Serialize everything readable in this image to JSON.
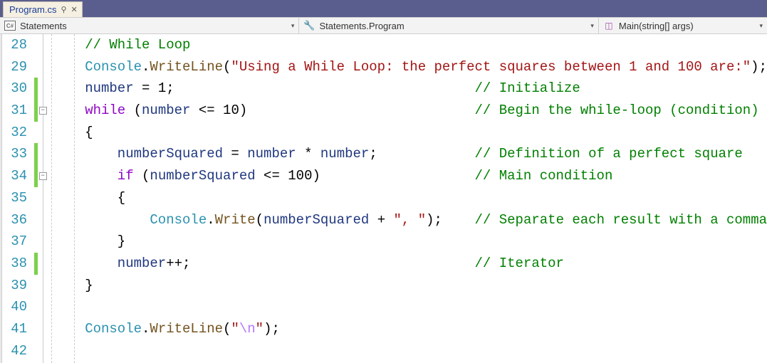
{
  "tab": {
    "title": "Program.cs",
    "pin_glyph": "⚲",
    "close_glyph": "✕"
  },
  "nav": {
    "namespace": "Statements",
    "class": "Statements.Program",
    "method": "Main(string[] args)",
    "csharp_badge": "C#",
    "class_glyph": "🔧",
    "method_glyph": "◫"
  },
  "gutter": {
    "start": 28,
    "end": 42
  },
  "outline": {
    "minus": "−"
  },
  "code": {
    "lines": [
      {
        "n": 28,
        "indent": 0,
        "segs": [
          [
            "comment",
            "// While Loop"
          ]
        ]
      },
      {
        "n": 29,
        "indent": 0,
        "segs": [
          [
            "type",
            "Console"
          ],
          [
            "punc",
            "."
          ],
          [
            "method",
            "WriteLine"
          ],
          [
            "punc",
            "("
          ],
          [
            "string",
            "\"Using a While Loop: the perfect squares between 1 and 100 are:\""
          ],
          [
            "punc",
            ");"
          ]
        ]
      },
      {
        "n": 30,
        "indent": 0,
        "segs": [
          [
            "ident",
            "number"
          ],
          [
            "op",
            " = "
          ],
          [
            "punc",
            "1;"
          ]
        ],
        "comment": "// Initialize",
        "chg": true
      },
      {
        "n": 31,
        "indent": 0,
        "segs": [
          [
            "flow",
            "while"
          ],
          [
            "punc",
            " ("
          ],
          [
            "ident",
            "number"
          ],
          [
            "op",
            " <= "
          ],
          [
            "punc",
            "10)"
          ]
        ],
        "comment": "// Begin the while-loop (condition)",
        "chg": true,
        "fold": true
      },
      {
        "n": 32,
        "indent": 0,
        "segs": [
          [
            "punc",
            "{"
          ]
        ]
      },
      {
        "n": 33,
        "indent": 1,
        "segs": [
          [
            "ident",
            "numberSquared"
          ],
          [
            "op",
            " = "
          ],
          [
            "ident",
            "number"
          ],
          [
            "op",
            " * "
          ],
          [
            "ident",
            "number"
          ],
          [
            "punc",
            ";"
          ]
        ],
        "comment": "// Definition of a perfect square",
        "chg": true
      },
      {
        "n": 34,
        "indent": 1,
        "segs": [
          [
            "flow",
            "if"
          ],
          [
            "punc",
            " ("
          ],
          [
            "ident",
            "numberSquared"
          ],
          [
            "op",
            " <= "
          ],
          [
            "punc",
            "100)"
          ]
        ],
        "comment": "// Main condition",
        "chg": true,
        "fold": true
      },
      {
        "n": 35,
        "indent": 1,
        "segs": [
          [
            "punc",
            "{"
          ]
        ]
      },
      {
        "n": 36,
        "indent": 2,
        "segs": [
          [
            "type",
            "Console"
          ],
          [
            "punc",
            "."
          ],
          [
            "method",
            "Write"
          ],
          [
            "punc",
            "("
          ],
          [
            "ident",
            "numberSquared"
          ],
          [
            "op",
            " + "
          ],
          [
            "string",
            "\", \""
          ],
          [
            "punc",
            ");"
          ]
        ],
        "comment": "// Separate each result with a comma"
      },
      {
        "n": 37,
        "indent": 1,
        "segs": [
          [
            "punc",
            "}"
          ]
        ]
      },
      {
        "n": 38,
        "indent": 1,
        "segs": [
          [
            "ident",
            "number"
          ],
          [
            "op",
            "++;"
          ]
        ],
        "comment": "// Iterator",
        "chg": true
      },
      {
        "n": 39,
        "indent": 0,
        "segs": [
          [
            "punc",
            "}"
          ]
        ]
      },
      {
        "n": 40,
        "indent": 0,
        "segs": []
      },
      {
        "n": 41,
        "indent": 0,
        "segs": [
          [
            "type",
            "Console"
          ],
          [
            "punc",
            "."
          ],
          [
            "method",
            "WriteLine"
          ],
          [
            "punc",
            "("
          ],
          [
            "string",
            "\""
          ],
          [
            "escape",
            "\\n"
          ],
          [
            "string",
            "\""
          ],
          [
            "punc",
            ");"
          ]
        ]
      },
      {
        "n": 42,
        "indent": 0,
        "segs": []
      }
    ],
    "comment_col": 48
  }
}
